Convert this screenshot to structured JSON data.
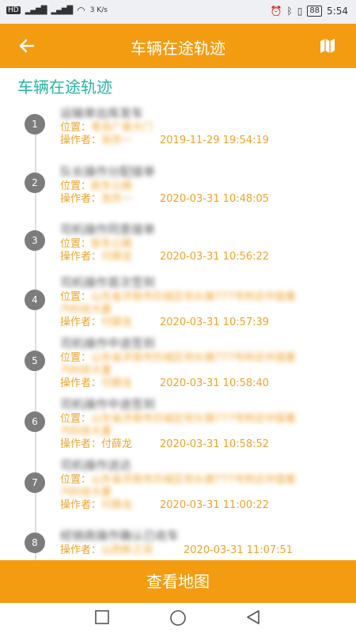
{
  "status_bar": {
    "left_text": "HD",
    "network_speed": "3 K/s",
    "battery": "88",
    "time": "5:54"
  },
  "toolbar": {
    "title": "车辆在途轨迹",
    "back_icon": "arrow-left-icon",
    "map_icon": "map-icon"
  },
  "section_title": "车辆在途轨迹",
  "labels": {
    "location": "位置：",
    "operator": "操作者："
  },
  "timeline": [
    {
      "index": "1",
      "title": "运输单出库发车",
      "location": "青岛广泰大门",
      "operator": "张庆一",
      "time": "2019-11-29 19:54:19"
    },
    {
      "index": "2",
      "title": "队长操作分配接单",
      "location": "胶东公路",
      "operator": "张庆一",
      "time": "2020-03-31 10:48:05"
    },
    {
      "index": "3",
      "title": "司机操作同意接单",
      "location": "胶东公路",
      "operator": "付薛龙",
      "time": "2020-03-31 10:56:22"
    },
    {
      "index": "4",
      "title": "司机操作首次签到",
      "location": "山东省济南市历城区坝头镇777号附近中国重汽科技大厦",
      "operator": "付薛龙",
      "time": "2020-03-31 10:57:39"
    },
    {
      "index": "5",
      "title": "司机操作中途签到",
      "location": "山东省济南市历城区坝头镇777号附近中国重汽科技大厦",
      "operator": "付薛龙",
      "time": "2020-03-31 10:58:40"
    },
    {
      "index": "6",
      "title": "司机操作中途签到",
      "location": "山东省济南市历城区坝头镇777号附近中国重汽科技大厦",
      "operator": "付薛龙",
      "time": "2020-03-31 10:58:52"
    },
    {
      "index": "7",
      "title": "司机操作送达",
      "location": "山东省济南市历城区坝头镇777号附近中国重汽科技大厦",
      "operator": "付薛龙",
      "time": "2020-03-31 11:00:22"
    },
    {
      "index": "8",
      "title": "经销商操作确认已收车",
      "operator": "山西新之润",
      "time": "2020-03-31 11:07:51"
    }
  ],
  "bottom_button": "查看地图",
  "navbar": {
    "recent_icon": "square-icon",
    "home_icon": "circle-icon",
    "back_icon": "triangle-back-icon"
  }
}
